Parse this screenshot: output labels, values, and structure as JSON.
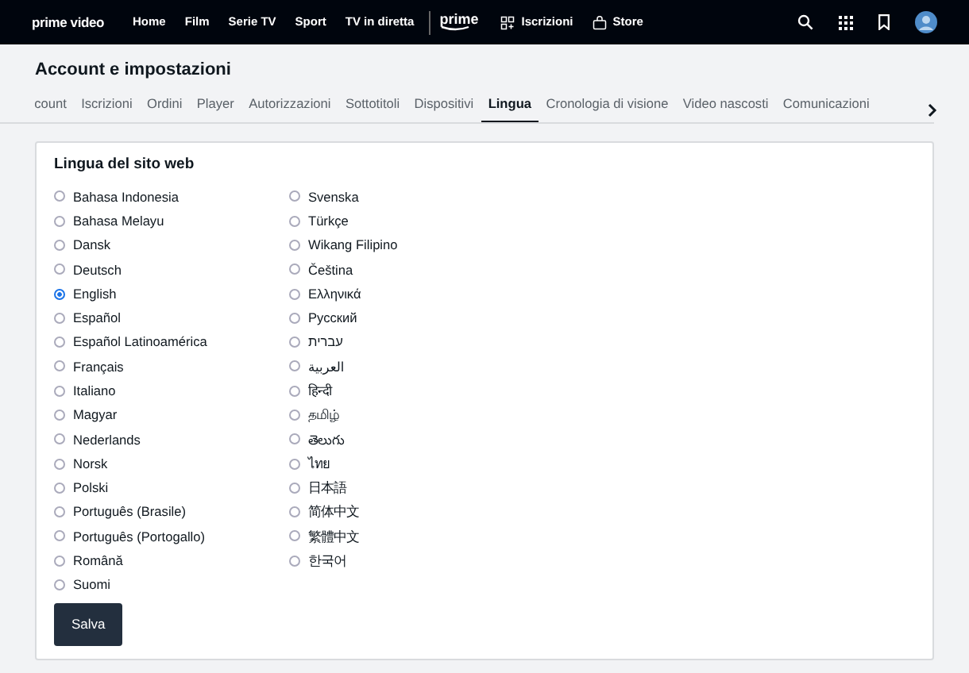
{
  "navbar": {
    "logo": "prime video",
    "links": [
      {
        "label": "Home"
      },
      {
        "label": "Film"
      },
      {
        "label": "Serie TV"
      },
      {
        "label": "Sport"
      },
      {
        "label": "TV in diretta"
      }
    ],
    "prime_logo": "prime",
    "extra_links": [
      {
        "label": "Iscrizioni"
      },
      {
        "label": "Store"
      }
    ]
  },
  "page_title": "Account e impostazioni",
  "tabs": [
    {
      "label": "count",
      "selected": false
    },
    {
      "label": "Iscrizioni",
      "selected": false
    },
    {
      "label": "Ordini",
      "selected": false
    },
    {
      "label": "Player",
      "selected": false
    },
    {
      "label": "Autorizzazioni",
      "selected": false
    },
    {
      "label": "Sottotitoli",
      "selected": false
    },
    {
      "label": "Dispositivi",
      "selected": false
    },
    {
      "label": "Lingua",
      "selected": true
    },
    {
      "label": "Cronologia di visione",
      "selected": false
    },
    {
      "label": "Video nascosti",
      "selected": false
    },
    {
      "label": "Comunicazioni",
      "selected": false
    }
  ],
  "section_title": "Lingua del sito web",
  "language_columns": [
    [
      {
        "label": "Bahasa Indonesia",
        "selected": false
      },
      {
        "label": "Bahasa Melayu",
        "selected": false
      },
      {
        "label": "Dansk",
        "selected": false
      },
      {
        "label": "Deutsch",
        "selected": false
      },
      {
        "label": "English",
        "selected": true
      },
      {
        "label": "Español",
        "selected": false
      },
      {
        "label": "Español Latinoamérica",
        "selected": false
      },
      {
        "label": "Français",
        "selected": false
      },
      {
        "label": "Italiano",
        "selected": false
      },
      {
        "label": "Magyar",
        "selected": false
      },
      {
        "label": "Nederlands",
        "selected": false
      },
      {
        "label": "Norsk",
        "selected": false
      },
      {
        "label": "Polski",
        "selected": false
      },
      {
        "label": "Português (Brasile)",
        "selected": false
      },
      {
        "label": "Português (Portogallo)",
        "selected": false
      },
      {
        "label": "Română",
        "selected": false
      },
      {
        "label": "Suomi",
        "selected": false
      }
    ],
    [
      {
        "label": "Svenska",
        "selected": false
      },
      {
        "label": "Türkçe",
        "selected": false
      },
      {
        "label": "Wikang Filipino",
        "selected": false
      },
      {
        "label": "Čeština",
        "selected": false
      },
      {
        "label": "Ελληνικά",
        "selected": false
      },
      {
        "label": "Русский",
        "selected": false
      },
      {
        "label": "עברית",
        "selected": false
      },
      {
        "label": "العربية",
        "selected": false
      },
      {
        "label": "हिन्दी",
        "selected": false
      },
      {
        "label": "தமிழ்",
        "selected": false
      },
      {
        "label": "తెలుగు",
        "selected": false
      },
      {
        "label": "ไทย",
        "selected": false
      },
      {
        "label": "日本語",
        "selected": false
      },
      {
        "label": "简体中文",
        "selected": false
      },
      {
        "label": "繁體中文",
        "selected": false
      },
      {
        "label": "한국어",
        "selected": false
      }
    ]
  ],
  "save_button": "Salva"
}
